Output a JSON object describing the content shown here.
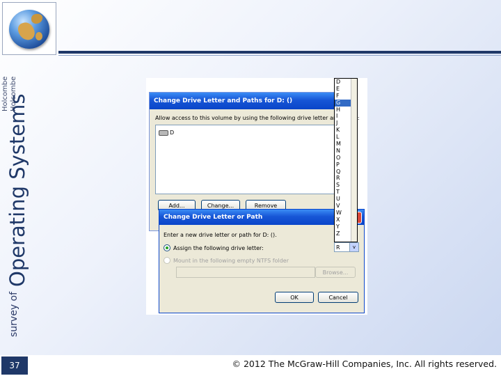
{
  "slide": {
    "series_title_small": "survey of",
    "series_title_large": "Operating Systems",
    "author_line_1": "Holcombe",
    "author_line_2": "Holcombe",
    "page_number": "37",
    "copyright": "© 2012 The McGraw-Hill Companies, Inc. All rights reserved.",
    "colors": {
      "accent": "#1f3868",
      "footer_page_box": "#1f3868"
    }
  },
  "back_dialog": {
    "title": "Change Drive Letter and Paths for D: ()",
    "description": "Allow access to this volume by using the following drive letter and paths:",
    "list_items": [
      "D"
    ],
    "buttons": {
      "add": "Add...",
      "change": "Change...",
      "remove": "Remove"
    }
  },
  "front_dialog": {
    "title": "Change Drive Letter or Path",
    "description": "Enter a new drive letter or path for D: ().",
    "option_assign": "Assign the following drive letter:",
    "option_mount": "Mount in the following empty NTFS folder",
    "browse_label": "Browse...",
    "ok_label": "OK",
    "cancel_label": "Cancel",
    "close_glyph": "x"
  },
  "drive_letter_dropdown": {
    "letters": [
      "D",
      "E",
      "F",
      "G",
      "H",
      "I",
      "J",
      "K",
      "L",
      "M",
      "N",
      "O",
      "P",
      "Q",
      "R",
      "S",
      "T",
      "U",
      "V",
      "W",
      "X",
      "Y",
      "Z"
    ],
    "highlighted": "G",
    "selected_value": "R",
    "combo_arrow": "v"
  }
}
